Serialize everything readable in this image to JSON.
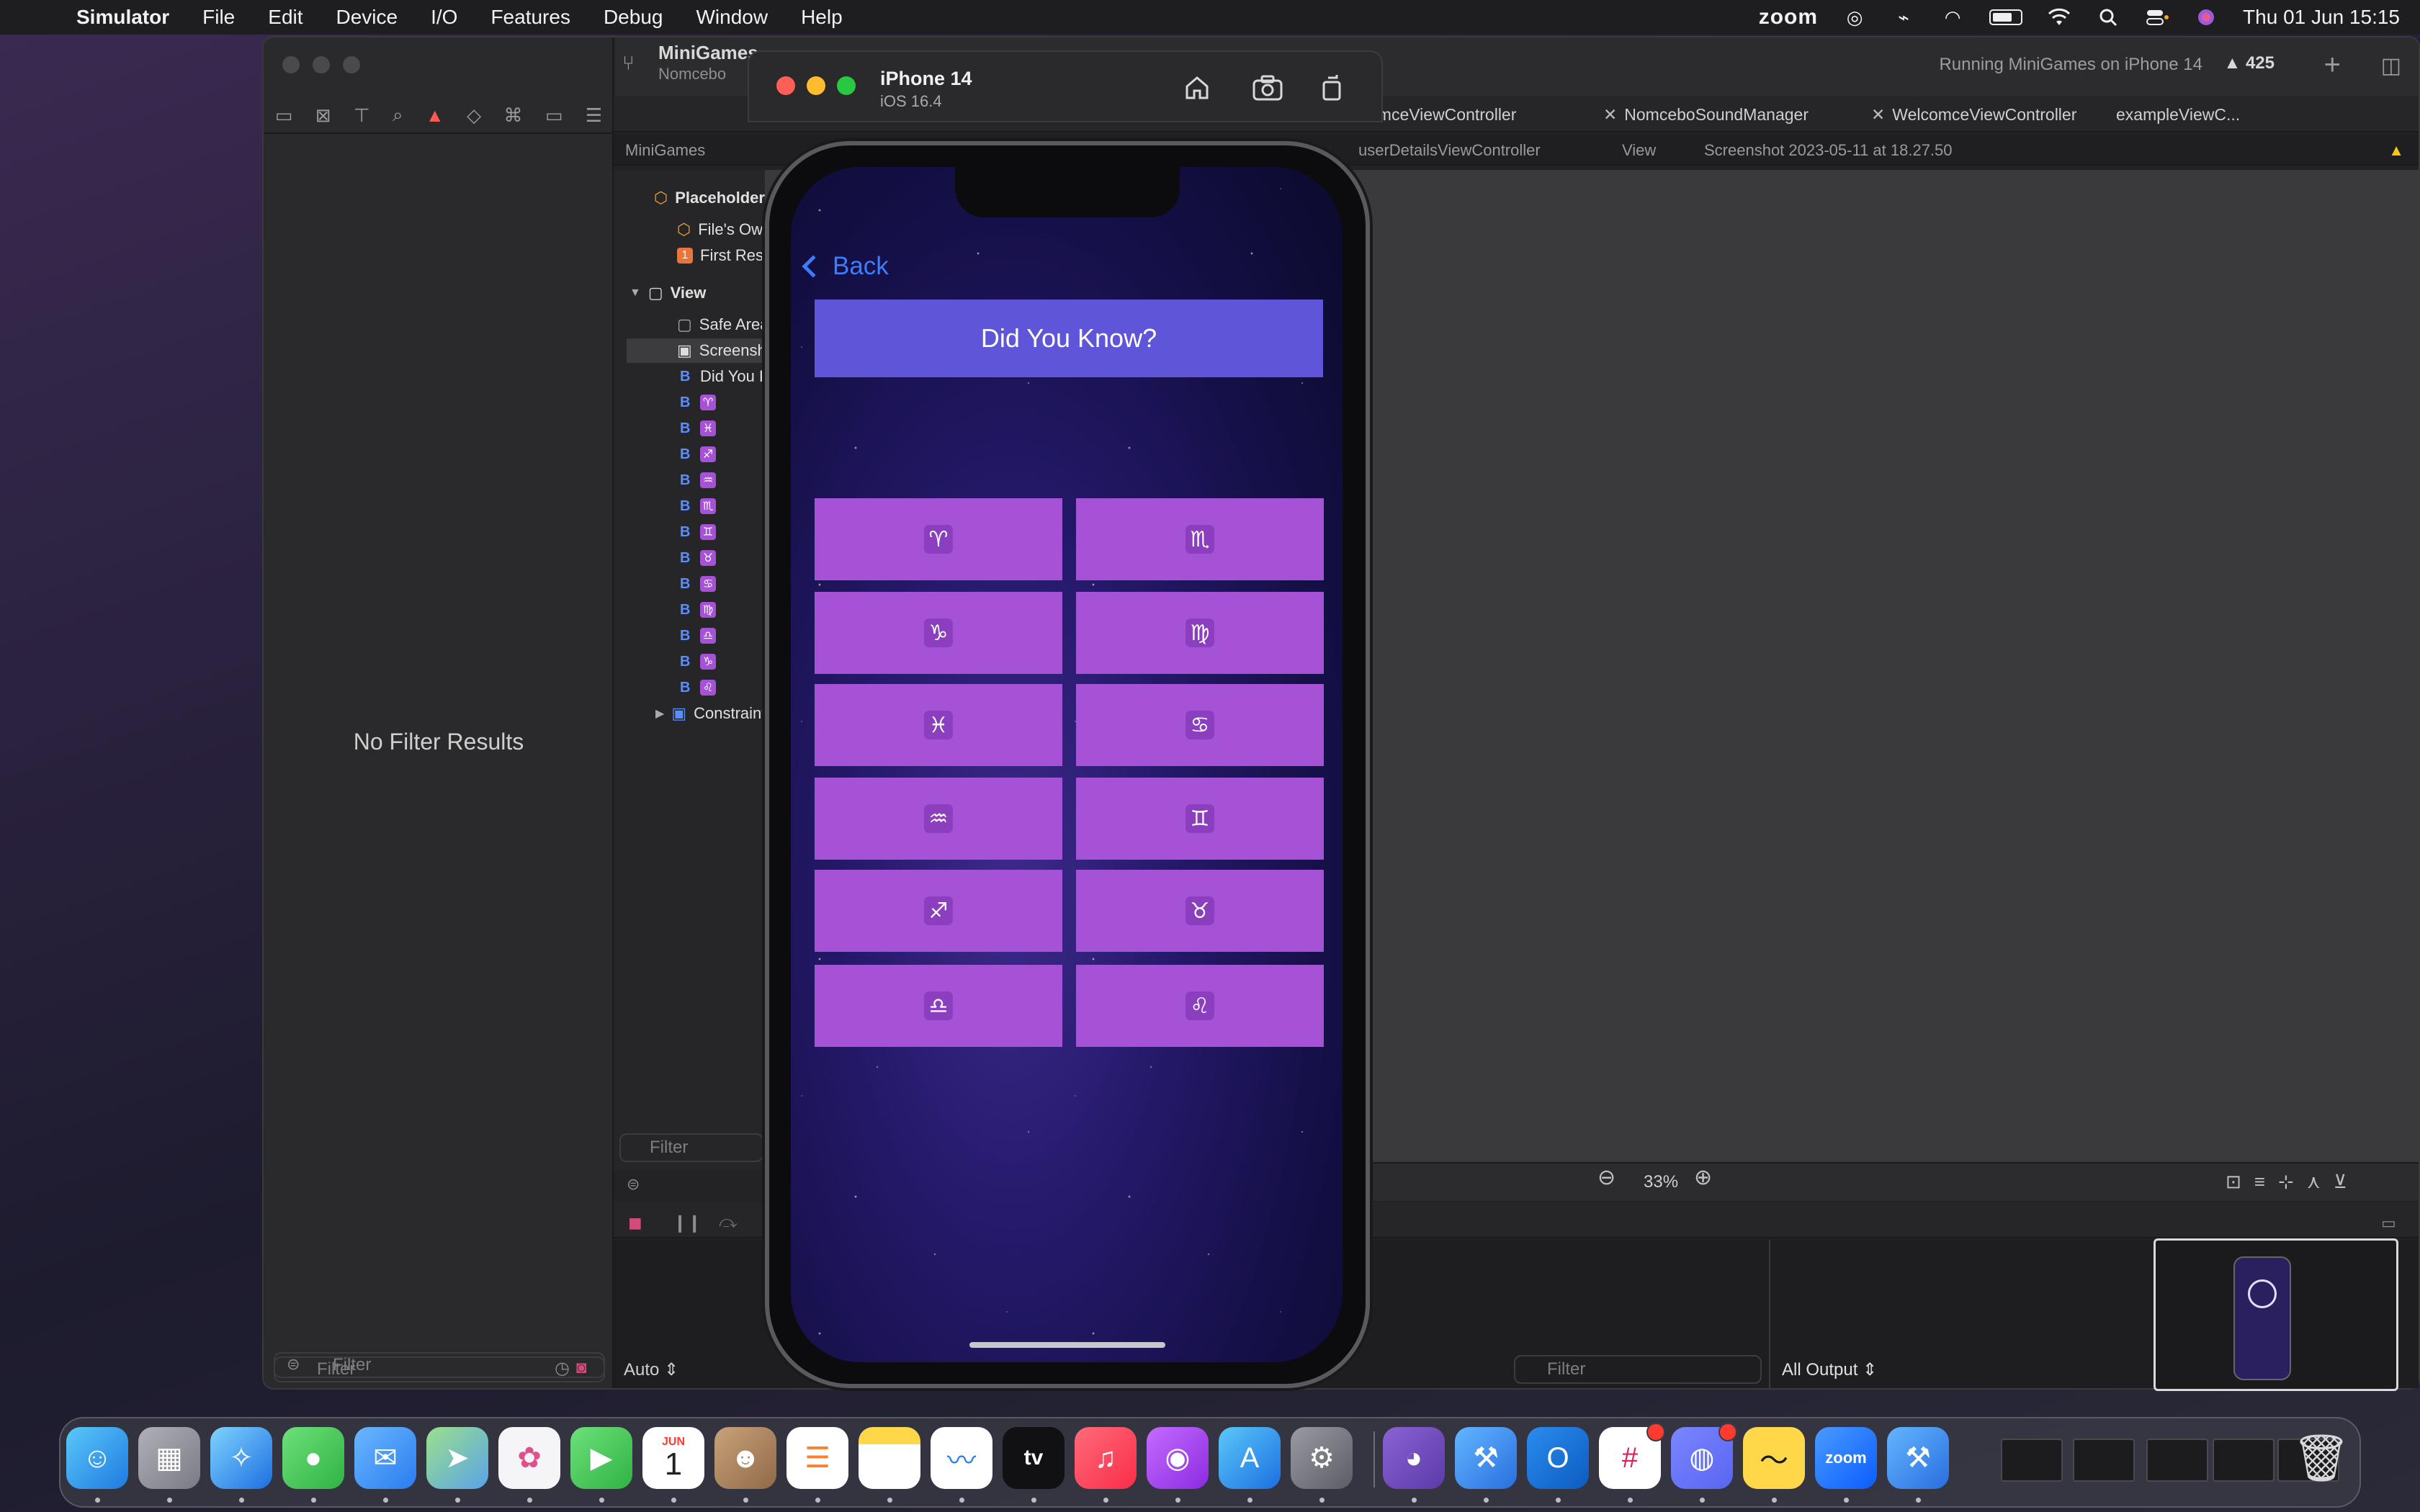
{
  "menubar": {
    "app_name": "Simulator",
    "items": [
      "File",
      "Edit",
      "Device",
      "I/O",
      "Features",
      "Debug",
      "Window",
      "Help"
    ],
    "zoom_label": "zoom",
    "datetime": "Thu 01 Jun  15:15"
  },
  "xcode": {
    "project_name": "MiniGames",
    "project_sub": "Nomcebo",
    "run_status": "Running MiniGames on iPhone 14",
    "warning_count": "425",
    "tabs": [
      "omceViewController",
      "NomceboSoundManager",
      "WelcomceViewController",
      "exampleViewC..."
    ],
    "jumpbar": [
      "MiniGames",
      "userDetailsViewController",
      "View",
      "Screenshot 2023-05-11 at 18.27.50"
    ],
    "no_filter_results": "No Filter Results",
    "nav_filter_placeholder": "Filter",
    "outline": {
      "placeholders": "Placeholders",
      "files_owner": "File's Owner",
      "first_responder": "First Responder",
      "view": "View",
      "safe_area": "Safe Area",
      "screenshot": "Screenshot",
      "did_you_know": "Did You Know?",
      "zodiac_glyphs": [
        "♈",
        "♓",
        "♐",
        "♒",
        "♏",
        "♊",
        "♉",
        "♋",
        "♍",
        "♎",
        "♑",
        "♌"
      ],
      "constraints": "Constraints"
    },
    "outline_filter_placeholder": "Filter",
    "zoom_level": "33%",
    "debug": {
      "auto_label": "Auto",
      "output_filter_placeholder": "Filter",
      "all_output": "All Output"
    }
  },
  "simulator": {
    "device_name": "iPhone 14",
    "os_version": "iOS 16.4"
  },
  "app": {
    "back_label": "Back",
    "did_you_know_label": "Did You Know?",
    "zodiac_buttons": [
      {
        "glyph": "♈"
      },
      {
        "glyph": "♏"
      },
      {
        "glyph": "♑"
      },
      {
        "glyph": "♍"
      },
      {
        "glyph": "♓"
      },
      {
        "glyph": "♋"
      },
      {
        "glyph": "♒"
      },
      {
        "glyph": "♊"
      },
      {
        "glyph": "♐"
      },
      {
        "glyph": "♉"
      },
      {
        "glyph": "♎"
      },
      {
        "glyph": "♌"
      }
    ],
    "colors": {
      "accent_blue": "#3d7bff",
      "header_button": "#5e55d8",
      "zodiac_button": "#a552d6"
    }
  },
  "dock": {
    "apps": [
      "Finder",
      "Launchpad",
      "Safari",
      "Messages",
      "Mail",
      "Maps",
      "Photos",
      "FaceTime",
      "Calendar",
      "Contacts",
      "Reminders",
      "Notes",
      "Freeform",
      "TV",
      "Music",
      "Podcasts",
      "App Store",
      "System Settings",
      "GitHub Desktop",
      "Xcode",
      "Outlook",
      "Slack",
      "Discord",
      "Basecamp",
      "Zoom",
      "Xcode Beta",
      "Trash"
    ],
    "calendar_month": "JUN",
    "calendar_day": "1",
    "tv_label": "tv",
    "zoom_label": "zoom"
  }
}
